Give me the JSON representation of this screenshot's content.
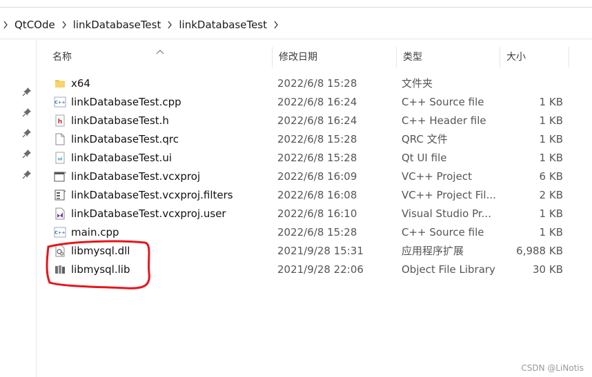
{
  "breadcrumb": {
    "items": [
      "QtCOde",
      "linkDatabaseTest",
      "linkDatabaseTest"
    ]
  },
  "columns": {
    "name": "名称",
    "date": "修改日期",
    "type": "类型",
    "size": "大小"
  },
  "files": [
    {
      "name": "x64",
      "date": "2022/6/8 15:28",
      "type": "文件夹",
      "size": "",
      "icon": "folder-icon"
    },
    {
      "name": "linkDatabaseTest.cpp",
      "date": "2022/6/8 16:24",
      "type": "C++ Source file",
      "size": "1 KB",
      "icon": "cpp-file-icon"
    },
    {
      "name": "linkDatabaseTest.h",
      "date": "2022/6/8 16:24",
      "type": "C++ Header file",
      "size": "1 KB",
      "icon": "header-file-icon"
    },
    {
      "name": "linkDatabaseTest.qrc",
      "date": "2022/6/8 15:28",
      "type": "QRC 文件",
      "size": "1 KB",
      "icon": "blank-file-icon"
    },
    {
      "name": "linkDatabaseTest.ui",
      "date": "2022/6/8 15:28",
      "type": "Qt UI file",
      "size": "1 KB",
      "icon": "ui-file-icon"
    },
    {
      "name": "linkDatabaseTest.vcxproj",
      "date": "2022/6/8 16:09",
      "type": "VC++ Project",
      "size": "6 KB",
      "icon": "vcxproj-file-icon"
    },
    {
      "name": "linkDatabaseTest.vcxproj.filters",
      "date": "2022/6/8 16:08",
      "type": "VC++ Project Fil...",
      "size": "2 KB",
      "icon": "filters-file-icon"
    },
    {
      "name": "linkDatabaseTest.vcxproj.user",
      "date": "2022/6/8 16:10",
      "type": "Visual Studio Pr...",
      "size": "1 KB",
      "icon": "vs-user-file-icon"
    },
    {
      "name": "main.cpp",
      "date": "2022/6/8 15:28",
      "type": "C++ Source file",
      "size": "1 KB",
      "icon": "cpp-file-icon"
    },
    {
      "name": "libmysql.dll",
      "date": "2021/9/28 15:31",
      "type": "应用程序扩展",
      "size": "6,988 KB",
      "icon": "dll-file-icon"
    },
    {
      "name": "libmysql.lib",
      "date": "2021/9/28 22:06",
      "type": "Object File Library",
      "size": "30 KB",
      "icon": "lib-file-icon"
    }
  ],
  "watermark": "CSDN @LiNotis",
  "colors": {
    "annotation": "#e8141b",
    "folder": "#f5c542",
    "cpp_label": "#3a6fb5",
    "header_label": "#c0272d"
  }
}
